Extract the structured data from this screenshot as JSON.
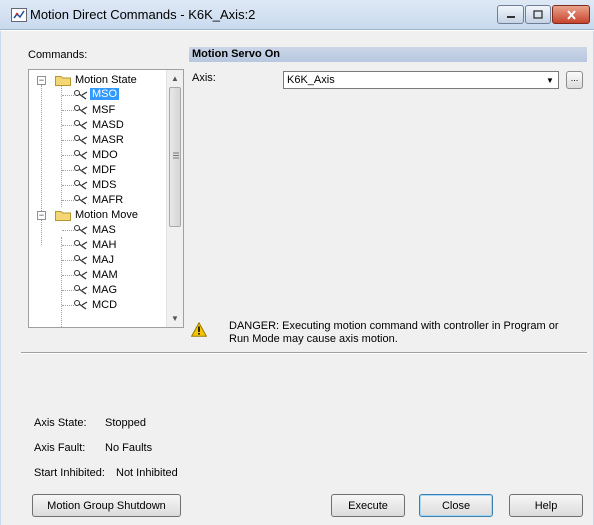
{
  "window": {
    "title": "Motion Direct Commands - K6K_Axis:2",
    "controls": [
      "minimize",
      "maximize",
      "close"
    ]
  },
  "commands_label": "Commands:",
  "tree": {
    "groups": [
      {
        "label": "Motion State",
        "expanded": true,
        "items": [
          "MSO",
          "MSF",
          "MASD",
          "MASR",
          "MDO",
          "MDF",
          "MDS",
          "MAFR"
        ]
      },
      {
        "label": "Motion Move",
        "expanded": true,
        "items": [
          "MAS",
          "MAH",
          "MAJ",
          "MAM",
          "MAG",
          "MCD"
        ]
      }
    ],
    "selected": "MSO"
  },
  "panel": {
    "title": "Motion Servo On",
    "axis_label": "Axis:",
    "axis_value": "K6K_Axis",
    "browse_label": "..."
  },
  "warning": {
    "text": "DANGER: Executing motion command with controller in Program or Run Mode may cause axis motion."
  },
  "status": {
    "axis_state_label": "Axis State:",
    "axis_state_value": "Stopped",
    "axis_fault_label": "Axis Fault:",
    "axis_fault_value": "No Faults",
    "start_inhibited_label": "Start Inhibited:",
    "start_inhibited_value": "Not Inhibited"
  },
  "buttons": {
    "shutdown": "Motion Group Shutdown",
    "execute": "Execute",
    "close": "Close",
    "help": "Help"
  },
  "colors": {
    "selection": "#3399ff",
    "header_bar": "#c3d2e6",
    "warning": "#f5c400"
  }
}
